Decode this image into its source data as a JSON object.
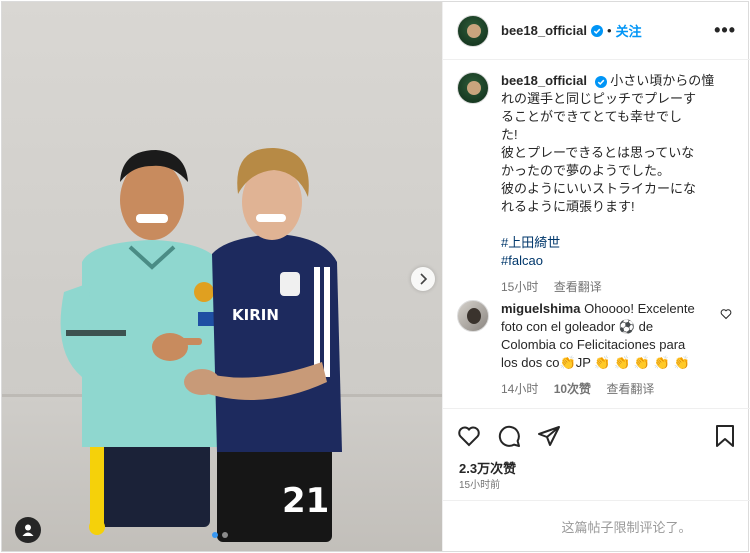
{
  "post": {
    "username": "bee18_official",
    "follow_label": "关注",
    "more_label": "•••",
    "caption_lines": [
      "小さい頃からの憧",
      "れの選手と同じピッチでプレーす",
      "ることができてとても幸せでし",
      "た!",
      "彼とプレーできるとは思っていな",
      "かったので夢のようでした。",
      "彼のようにいいストライカーにな",
      "れるように頑張ります!"
    ],
    "hashtags": [
      "#上田綺世",
      "#falcao"
    ],
    "time_ago": "15小时",
    "translate_label": "查看翻译"
  },
  "comment": {
    "username": "miguelshima",
    "text_lines": [
      "Ohoooo! Excelente",
      "foto con el goleador ⚽ de",
      "Colombia co Felicitaciones para",
      "los dos co👏JP 👏 👏 👏 👏 👏"
    ],
    "time_ago": "14小时",
    "likes": "10次赞",
    "translate_label": "查看翻译"
  },
  "stats": {
    "likes": "2.3万次赞",
    "posted": "15小时前"
  },
  "footer": {
    "comments_limited": "这篇帖子限制评论了。"
  },
  "colors": {
    "accent": "#0095f6",
    "jersey_colombia": "#8ed8d0",
    "jersey_japan": "#1d2a5e"
  }
}
